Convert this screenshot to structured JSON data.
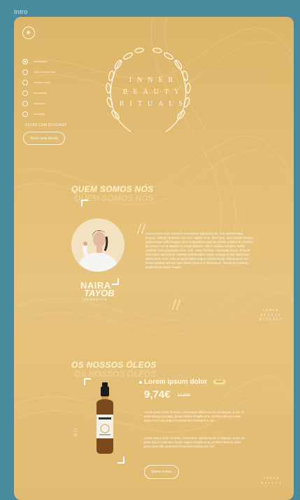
{
  "frame": {
    "label": "Intro"
  },
  "nav": {
    "items": [
      {
        "label": "Introdução",
        "active": true
      },
      {
        "label": "Quem somos nós"
      },
      {
        "label": "Nossos óleos"
      },
      {
        "label": "Benefícios"
      },
      {
        "label": "Opiniões"
      },
      {
        "label": "Contacto"
      }
    ]
  },
  "help": {
    "question": "ESTÁS COM DÚVIDAS?",
    "button": "Tenho uma dúvida"
  },
  "brand": {
    "line1": "INNER",
    "line2": "BEAUTY",
    "line3": "RITUALS"
  },
  "about": {
    "title": "QUEM SOMOS NÓS",
    "founder_first": "NAIRA",
    "founder_last": "TAYOB",
    "founder_role": "fundadora",
    "body": "Lorem ipsum dolor sit amet, consectetur adipiscing elit. Duis pellentesque tempus, aliquam praesent sed urna sagittis vitae, diam arcu, eget aenean feugiat pellentesque pellentesque. Duis suspendisse gravida viverra sodales et. Facilisis dui ornare non at aliquam et mattis aliquam. Nisi et facilisis convallis mattis curabitur non sollicitudin netus. Velit, netus faucibus consequat lectus, dictumst odio luctus sed rutrum molestie pellentesque neque volutpat at nisi. Bibendum ullamcorper nunc. Non mi ligula mattis augue tempus iaculis aliquet proin. Eu lectus id tellus ut enim. Quis diam interdum in fermentum. Aliquet mi interdum suspendisse donec neque."
  },
  "side_brand": {
    "l1": "INNER",
    "l2": "BEAUTY",
    "l3": "RITUALS"
  },
  "oils": {
    "title": "OS NOSSOS ÓLEOS",
    "vertical": "OIL",
    "product_title": "Lorem ipsum dolor",
    "badge": "NOVO",
    "price": "9,74€",
    "old_price": "12,99€",
    "desc1": "Lorem ipsum dolor sit amet, consectetur adipiscing elit ut aliquam, purus sit amet luctus venenatis, lectus magna fringilla urna, porttitor rhoncus dolor purus non enim praesent elementum facilisis leo, vel.",
    "desc2": "Lorem ipsum dolor sit amet, consectetur adipiscing elit ut aliquam, purus sit amet luctus venenatis, lectus magna fringilla urna, porttitor rhoncus dolor purus non enim praesent elementum facilisis leo, vel.",
    "button": "Quero o meu"
  },
  "colors": {
    "background": "#4a8a9e",
    "card": "#e3bd74",
    "accent": "#fff1c7"
  }
}
